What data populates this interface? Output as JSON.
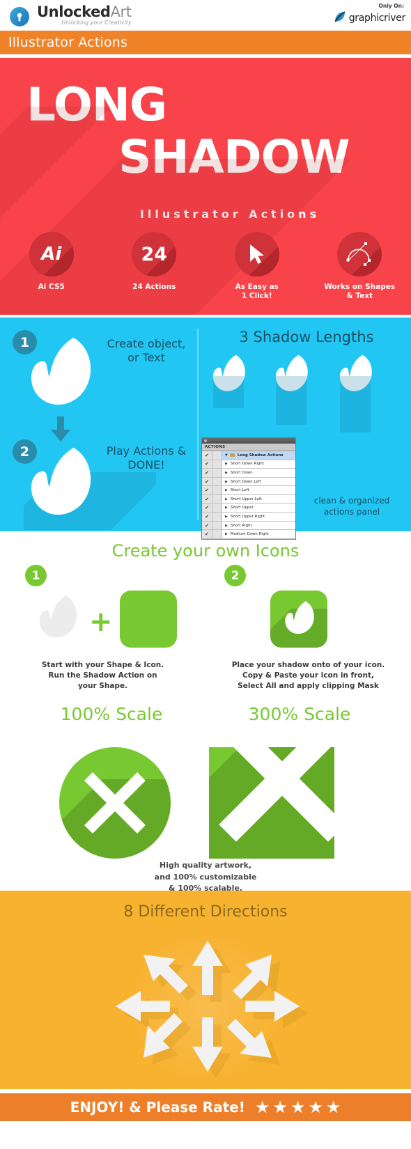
{
  "header": {
    "brand_name_bold": "Unlocked",
    "brand_name_light": "Art",
    "tagline": "Unlocking your Creativity",
    "only_on": "Only On:",
    "marketplace": "graphicriver"
  },
  "topbar": {
    "title": "Illustrator Actions"
  },
  "hero": {
    "line1": "LONG",
    "line2": "SHADOW",
    "subtitle": "Illustrator Actions",
    "bg_color": "#f8434a",
    "features": [
      {
        "glyph": "Ai",
        "icon": "illustrator-icon",
        "label_line1": "Ai CS5",
        "label_line2": ""
      },
      {
        "glyph": "24",
        "icon": "count-icon",
        "label_line1": "24 Actions",
        "label_line2": ""
      },
      {
        "glyph": "",
        "icon": "cursor-arrow-icon",
        "label_line1": "As Easy as",
        "label_line2": "1 Click!"
      },
      {
        "glyph": "",
        "icon": "bezier-pen-icon",
        "label_line1": "Works on Shapes",
        "label_line2": "& Text"
      }
    ]
  },
  "blue_section": {
    "bg_color": "#21c6f3",
    "step1_number": "1",
    "step1_text_line1": "Create object,",
    "step1_text_line2": "or Text",
    "step2_number": "2",
    "step2_text_line1": "Play Actions &",
    "step2_text_line2": "DONE!",
    "lengths_title": "3 Shadow Lengths",
    "panel_caption_line1": "clean & organized",
    "panel_caption_line2": "actions panel",
    "actions_panel": {
      "tab_label": "ACTIONS",
      "set_name": "Long Shadow Actions",
      "items": [
        "Short Down Right",
        "Short Down",
        "Short Down Left",
        "Short Left",
        "Short Upper Left",
        "Short Upper",
        "Short Upper Right",
        "Short Right",
        "Medium Down Right"
      ],
      "checkmark": "✔",
      "triangle": "▶"
    }
  },
  "icons_section": {
    "title": "Create your own Icons",
    "accent_color": "#78c832",
    "step1_number": "1",
    "step2_number": "2",
    "plus_symbol": "+",
    "caption1_line1": "Start with your Shape & Icon.",
    "caption1_line2": "Run the Shadow Action on",
    "caption1_line3": "your Shape.",
    "caption2_line1": "Place your shadow onto of your icon.",
    "caption2_line2": "Copy & Paste your icon in front,",
    "caption2_line3": "Select All and apply clipping Mask"
  },
  "scale_section": {
    "left_title": "100% Scale",
    "right_title": "300% Scale",
    "caption_line1": "High quality artwork,",
    "caption_line2": "and 100% customizable",
    "caption_line3": "& 100% scalable."
  },
  "directions_section": {
    "title": "8 Different Directions",
    "bg_color": "#f7b230",
    "arrow_count": 8
  },
  "footer": {
    "text": "ENJOY! & Please Rate!",
    "star_count": 5,
    "star_glyph": "★",
    "bg_color": "#ee7f2a"
  }
}
